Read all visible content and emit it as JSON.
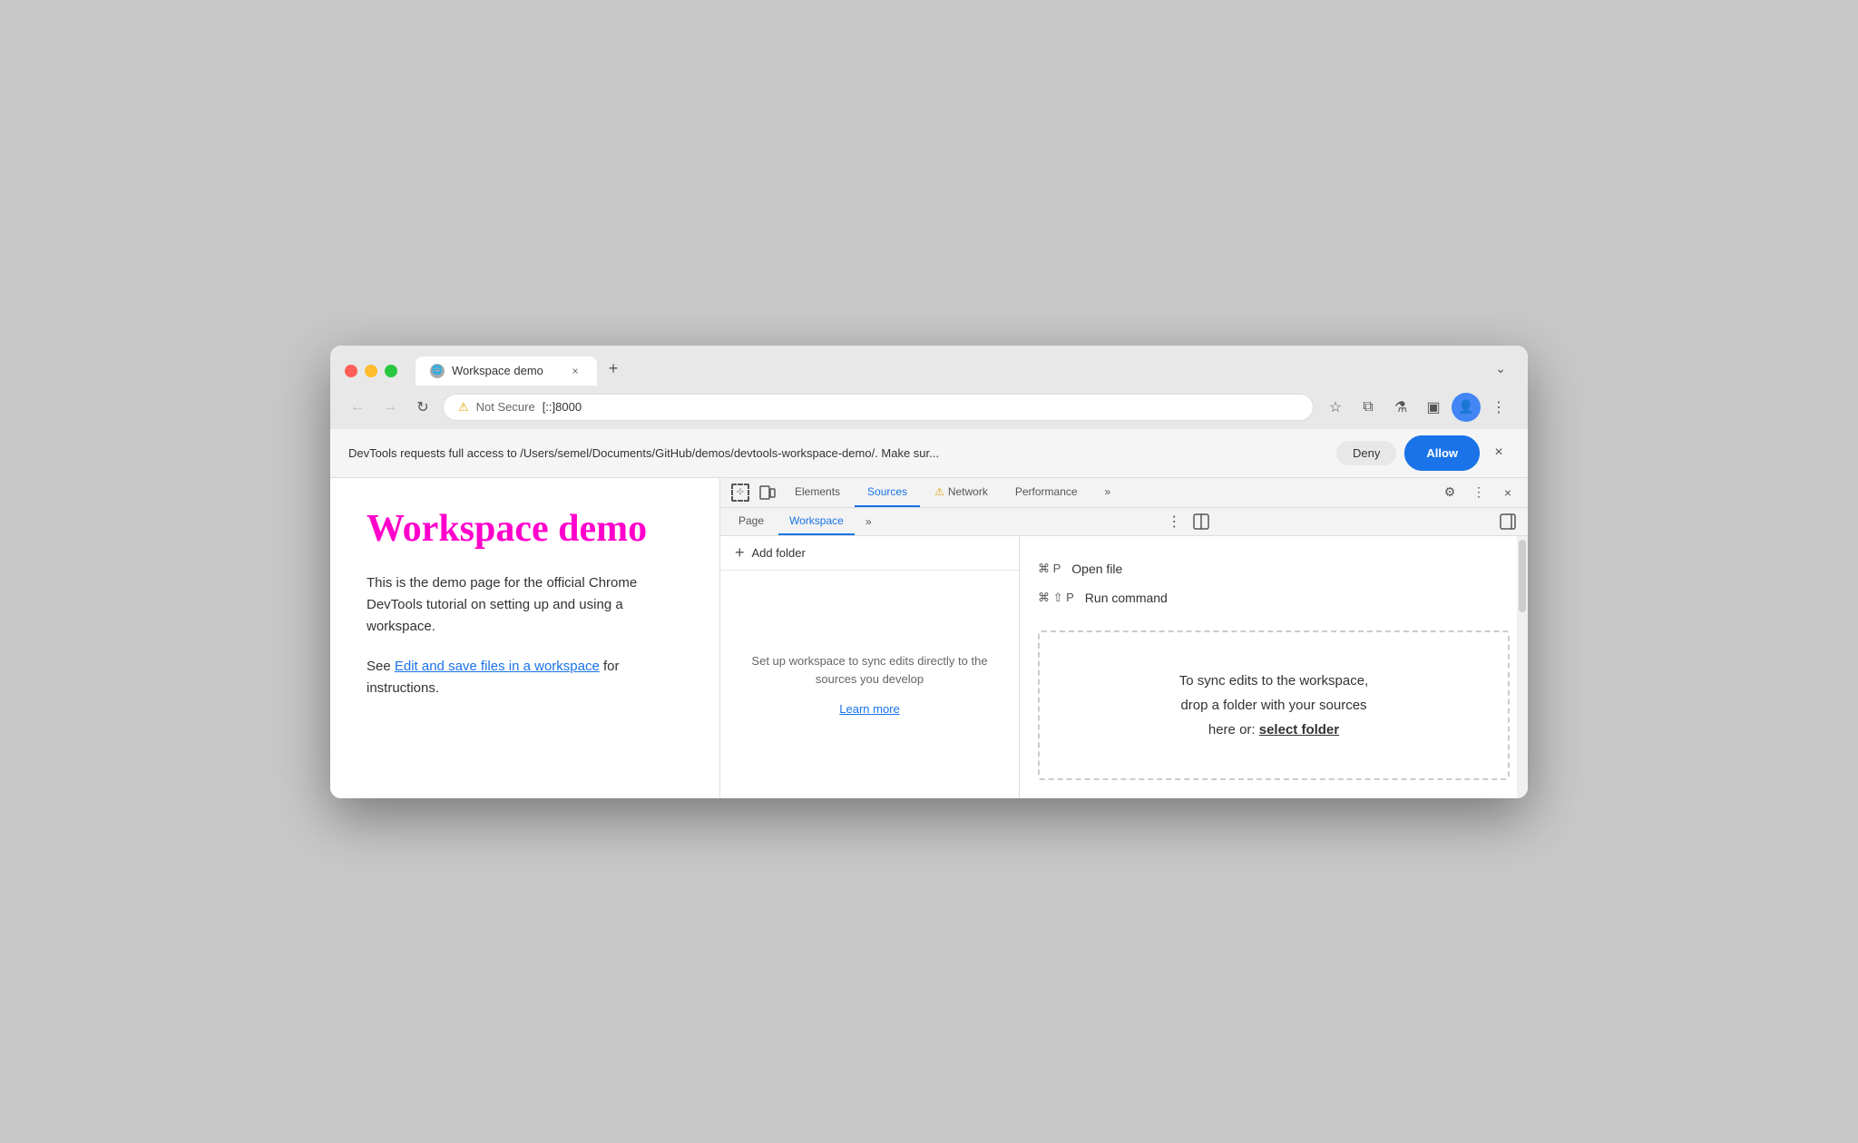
{
  "browser": {
    "tab": {
      "favicon": "🌐",
      "title": "Workspace demo",
      "close_label": "×"
    },
    "new_tab_label": "+",
    "tab_chevron": "⌄"
  },
  "toolbar": {
    "back_icon": "←",
    "forward_icon": "→",
    "refresh_icon": "↻",
    "not_secure_icon": "⚠",
    "not_secure_label": "Not Secure",
    "address": "[::]8000",
    "bookmark_icon": "☆",
    "extension_icon": "⧉",
    "lab_icon": "⚗",
    "sidebar_icon": "▣",
    "profile_icon": "👤",
    "menu_icon": "⋮"
  },
  "notification": {
    "text": "DevTools requests full access to /Users/semel/Documents/GitHub/demos/devtools-workspace-demo/. Make sur...",
    "deny_label": "Deny",
    "allow_label": "Allow",
    "close_icon": "×"
  },
  "page": {
    "title": "Workspace demo",
    "body1": "This is the demo page for the official Chrome DevTools tutorial on setting up and using a workspace.",
    "body2_prefix": "See ",
    "body2_link": "Edit and save files in a workspace",
    "body2_suffix": " for instructions."
  },
  "devtools": {
    "tabs": [
      {
        "label": "Elements",
        "active": false
      },
      {
        "label": "Sources",
        "active": true
      },
      {
        "label": "Network",
        "active": false
      },
      {
        "label": "Performance",
        "active": false
      },
      {
        "label": "»",
        "active": false
      }
    ],
    "gear_icon": "⚙",
    "kebab_icon": "⋮",
    "close_icon": "×",
    "network_warning_icon": "⚠",
    "subtabs": [
      {
        "label": "Page",
        "active": false
      },
      {
        "label": "Workspace",
        "active": true
      },
      {
        "label": "»",
        "active": false
      }
    ],
    "subtab_kebab": "⋮",
    "toggle_panel_icon": "◫",
    "side_panel_icon": "⬚",
    "add_folder_label": "Add folder",
    "empty_panel": {
      "text": "Set up workspace to sync edits directly to the sources you develop",
      "learn_more": "Learn more"
    },
    "shortcuts": [
      {
        "keys": "⌘ P",
        "desc": "Open file"
      },
      {
        "keys": "⌘ ⇧ P",
        "desc": "Run command"
      }
    ],
    "drop_area": {
      "line1": "To sync edits to the workspace,",
      "line2": "drop a folder with your sources",
      "line3_prefix": "here or: ",
      "line3_link": "select folder"
    }
  }
}
